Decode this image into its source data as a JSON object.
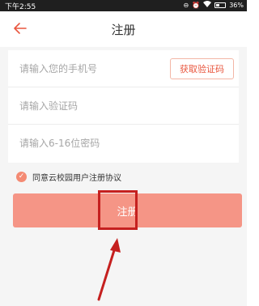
{
  "statusbar": {
    "time": "下午2:55",
    "battery_text": "36%",
    "battery_level": 0.36,
    "icons": [
      "dnd-icon",
      "alarm-icon",
      "wifi-icon",
      "battery-icon"
    ]
  },
  "navbar": {
    "title": "注册",
    "back_icon": "back-arrow-icon"
  },
  "form": {
    "phone_placeholder": "请输入您的手机号",
    "code_placeholder": "请输入验证码",
    "password_placeholder": "请输入6-16位密码",
    "get_code_label": "获取验证码"
  },
  "agreement": {
    "text": "同意云校园用户注册协议",
    "checked": true
  },
  "register_label": "注册",
  "colors": {
    "accent": "#e9573f",
    "button": "#f59586",
    "highlight": "#c5201f"
  }
}
